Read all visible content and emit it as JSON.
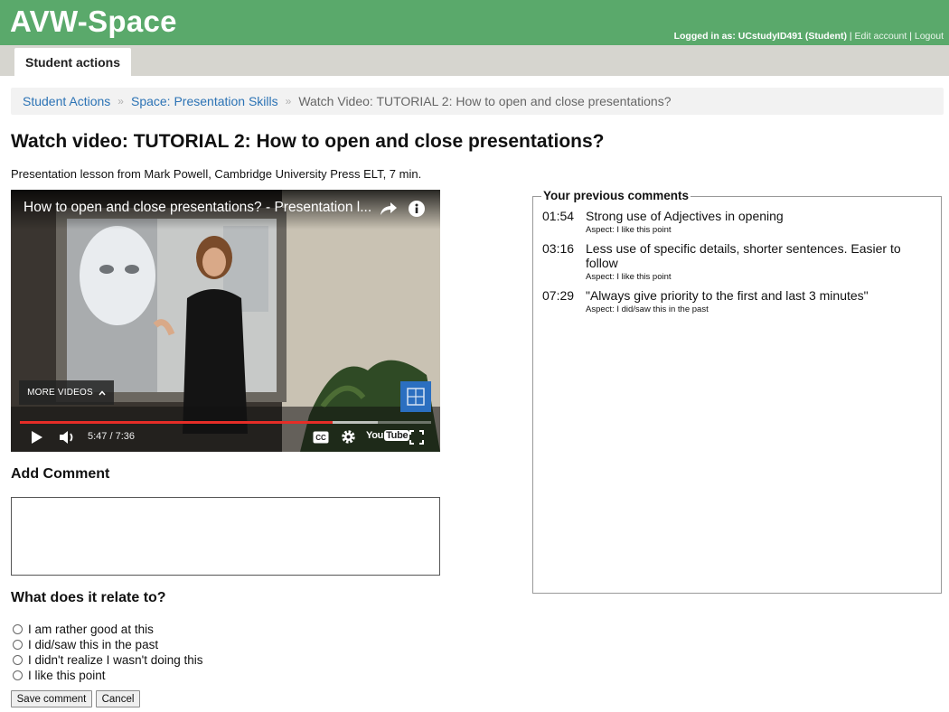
{
  "header": {
    "brand": "AVW-Space",
    "logged_in_prefix": "Logged in as: ",
    "user": "UCstudyID491 (Student)",
    "separator": " | ",
    "edit_account": "Edit account",
    "logout": "Logout",
    "bg_color": "#5aa96b"
  },
  "tabs": [
    {
      "label": "Student actions"
    }
  ],
  "breadcrumb": {
    "items": [
      "Student Actions",
      "Space: Presentation Skills"
    ],
    "separator": "»",
    "current": "Watch Video: TUTORIAL 2: How to open and close presentations?"
  },
  "page": {
    "title": "Watch video: TUTORIAL 2: How to open and close presentations?",
    "subtitle": "Presentation lesson from Mark Powell, Cambridge University Press ELT, 7 min."
  },
  "video": {
    "title": "How to open and close presentations? - Presentation l...",
    "more_videos": "MORE VIDEOS",
    "time": "5:47 / 7:36",
    "progress_fraction": 0.76,
    "buffer_fraction": 0.87,
    "youtube_logo_a": "You",
    "youtube_logo_b": "Tube",
    "cc_label": "CC",
    "icons": [
      "share-icon",
      "info-icon",
      "play-icon",
      "volume-icon",
      "chevron-up-icon",
      "captions-icon",
      "gear-icon",
      "fullscreen-icon"
    ]
  },
  "add_comment": {
    "heading": "Add Comment",
    "value": "",
    "placeholder": ""
  },
  "relate": {
    "heading": "What does it relate to?",
    "options": [
      "I am rather good at this",
      "I did/saw this in the past",
      "I didn't realize I wasn't doing this",
      "I like this point"
    ]
  },
  "buttons": {
    "save": "Save comment",
    "cancel": "Cancel"
  },
  "previous_comments": {
    "legend": "Your previous comments",
    "items": [
      {
        "time": "01:54",
        "text": "Strong use of Adjectives in opening",
        "aspect": "Aspect: I like this point"
      },
      {
        "time": "03:16",
        "text": "Less use of specific details, shorter sentences. Easier to follow",
        "aspect": "Aspect: I like this point"
      },
      {
        "time": "07:29",
        "text": "\"Always give priority to the first and last 3 minutes\"",
        "aspect": "Aspect: I did/saw this in the past"
      }
    ]
  }
}
